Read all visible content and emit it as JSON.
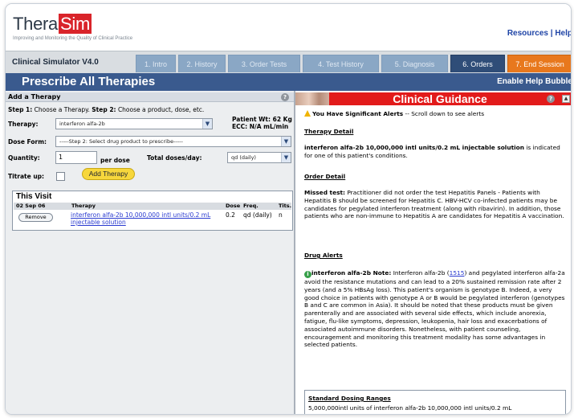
{
  "header": {
    "logo_part1": "Thera",
    "logo_part2": "Sim",
    "tagline": "Improving and Monitoring the Quality of Clinical Practice",
    "resources_link": "Resources | Help"
  },
  "tabbar": {
    "sim_title": "Clinical Simulator V4.0",
    "tabs": [
      {
        "label": "1. Intro"
      },
      {
        "label": "2. History"
      },
      {
        "label": "3. Order Tests"
      },
      {
        "label": "4. Test History"
      },
      {
        "label": "5. Diagnosis"
      },
      {
        "label": "6. Orders"
      },
      {
        "label": "7. End Session"
      }
    ]
  },
  "titlebar": {
    "title": "Prescribe All Therapies",
    "help_bubble": "Enable Help Bubble"
  },
  "add_therapy": {
    "section_title": "Add a Therapy",
    "help_icon": "?",
    "steps_step1": "Step 1:",
    "steps_text1": "Choose a Therapy.",
    "steps_step2": "Step 2:",
    "steps_text2": "Choose a product, dose, etc.",
    "therapy_label": "Therapy:",
    "therapy_value": "interferon alfa-2b",
    "patient_wt": "Patient Wt: 62 Kg",
    "ecc": "ECC: N/A mL/min",
    "dose_form_label": "Dose Form:",
    "dose_form_value": "-----Step 2: Select drug product to prescribe-----",
    "quantity_label": "Quantity:",
    "quantity_value": "1",
    "per_dose": "per dose",
    "total_doses_label": "Total doses/day:",
    "total_doses_value": "qd (daily)",
    "titrate_label": "Titrate up:",
    "add_button": "Add Therapy"
  },
  "this_visit": {
    "title": "This Visit",
    "columns": [
      "02 Sep 06",
      "Therapy",
      "Dose",
      "Freq.",
      "Tits."
    ],
    "rows": [
      {
        "remove": "Remove",
        "therapy": "interferon alfa-2b 10,000,000 intl units/0.2 mL injectable solution",
        "dose": "0.2",
        "freq": "qd (daily)",
        "tits": "n"
      }
    ]
  },
  "guidance": {
    "title": "Clinical Guidance",
    "alert_bold": "You Have Significant Alerts",
    "alert_rest": " -- Scroll down to see alerts",
    "therapy_detail_heading": "Therapy Detail",
    "therapy_detail_bold": "interferon alfa-2b 10,000,000 intl units/0.2 mL injectable solution",
    "therapy_detail_rest": " is indicated for one of this patient's conditions.",
    "order_detail_heading": "Order Detail",
    "missed_bold": "Missed test:",
    "missed_rest": " Practitioner did not order the test Hepatitis Panels - Patients with Hepatitis B should be screened for Hepatitis C. HBV-HCV co-infected patients may be candidates for pegylated interferon treatment (along with ribavirin). In addition, those patients who are non-immune to Hepatitis A are candidates for Hepatitis A vaccination.",
    "drug_alerts_heading": "Drug Alerts",
    "note_bold": "interferon alfa-2b Note:",
    "note_pre": " Interferon alfa-2b (",
    "note_link": "1515",
    "note_rest": ") and pegylated interferon alfa-2a avoid the resistance mutations and can lead to a 20% sustained remission rate after 2 years (and a 5% HBsAg loss). This patient's organism is genotype B. Indeed, a very good choice in patients with genotype A or B would be pegylated interferon (genotypes B and C are common in Asia). It should be noted that these products must be given parenterally and are associated with several side effects, which include anorexia, fatigue, flu-like symptoms, depression, leukopenia, hair loss and exacerbations of associated autoimmune disorders. Nonetheless, with patient counseling, encouragement and monitoring this treatment modality has some advantages in selected patients.",
    "dosing_heading": "Standard Dosing Ranges",
    "dosing_line": "5,000,000intl units of interferon alfa-2b 10,000,000 intl units/0.2 mL"
  },
  "icons": {
    "help": "question-icon",
    "warning": "warning-icon",
    "note": "info-icon",
    "dropdown": "chevron-down-icon"
  },
  "colors": {
    "tab_active": "#2f4d78",
    "tab_end": "#e8781d",
    "title_bar": "#3a5a8e",
    "guidance_bar": "#e21b1b",
    "add_button": "#f7d73c",
    "link": "#2a3bd0"
  }
}
